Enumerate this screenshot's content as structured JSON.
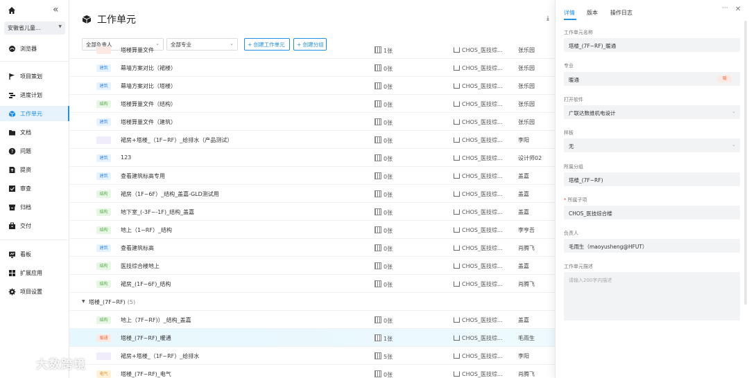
{
  "sidebar": {
    "project": "安徽省儿童...",
    "items": [
      {
        "label": "浏览器",
        "icon": "cloud-icon"
      },
      {
        "label": "项目策划",
        "icon": "flag-icon"
      },
      {
        "label": "进度计划",
        "icon": "schedule-icon"
      },
      {
        "label": "工作单元",
        "icon": "cube-icon",
        "active": true
      },
      {
        "label": "文档",
        "icon": "folder-icon"
      },
      {
        "label": "问题",
        "icon": "question-icon"
      },
      {
        "label": "提资",
        "icon": "submit-icon"
      },
      {
        "label": "审查",
        "icon": "review-icon"
      },
      {
        "label": "归档",
        "icon": "archive-icon"
      },
      {
        "label": "交付",
        "icon": "delivery-icon"
      },
      {
        "label": "看板",
        "icon": "dashboard-icon"
      },
      {
        "label": "扩展应用",
        "icon": "apps-icon"
      },
      {
        "label": "项目设置",
        "icon": "settings-icon"
      }
    ]
  },
  "main": {
    "title": "工作单元",
    "filters": {
      "owner": "全部负责人",
      "discipline": "全部专业"
    },
    "buttons": {
      "create_unit": "+ 创建工作单元",
      "create_group": "+ 创建分组"
    },
    "rows": [
      {
        "tag": "",
        "tag_class": "nt",
        "name": "塔楼算量文件",
        "count": "1张",
        "sub": "CHOS_医技综...",
        "owner": "张乐园"
      },
      {
        "tag": "建筑",
        "tag_class": "jz",
        "name": "幕墙方案对比（裙楼）",
        "count": "0张",
        "sub": "CHOS_医技综...",
        "owner": "张乐园"
      },
      {
        "tag": "建筑",
        "tag_class": "jz",
        "name": "幕墙方案对比（塔楼）",
        "count": "0张",
        "sub": "CHOS_医技综...",
        "owner": "张乐园"
      },
      {
        "tag": "结构",
        "tag_class": "jg",
        "name": "塔楼算量文件（结构）",
        "count": "0张",
        "sub": "CHOS_医技综...",
        "owner": "张乐园"
      },
      {
        "tag": "建筑",
        "tag_class": "jz",
        "name": "塔楼算量文件（建筑）",
        "count": "0张",
        "sub": "CHOS_医技综...",
        "owner": "张乐园"
      },
      {
        "tag": "",
        "tag_class": "gps",
        "name": "裙房+塔楼_（1F~RF）_给排水（产品测试）",
        "count": "0张",
        "sub": "CHOS_医技综...",
        "owner": "李阳"
      },
      {
        "tag": "建筑",
        "tag_class": "jz",
        "name": "123",
        "count": "0张",
        "sub": "CHOS_医技综...",
        "owner": "设计师02"
      },
      {
        "tag": "建筑",
        "tag_class": "jz",
        "name": "查看建筑标高专用",
        "count": "0张",
        "sub": "CHOS_医技综...",
        "owner": "盖嘉"
      },
      {
        "tag": "结构",
        "tag_class": "jg",
        "name": "裙房（1F~6F）_结构_盖嘉-GLD测试用",
        "count": "0张",
        "sub": "CHOS_医技综...",
        "owner": "盖嘉"
      },
      {
        "tag": "结构",
        "tag_class": "jg",
        "name": "地下室_(-3F~-1F)_结构_盖嘉",
        "count": "0张",
        "sub": "CHOS_医技综...",
        "owner": "盖嘉"
      },
      {
        "tag": "结构",
        "tag_class": "jg",
        "name": "地上（1~RF）_结构",
        "count": "0张",
        "sub": "CHOS_医技综...",
        "owner": "李亨吾"
      },
      {
        "tag": "建筑",
        "tag_class": "jz",
        "name": "查看建筑标高",
        "count": "0张",
        "sub": "CHOS_医技综...",
        "owner": "肖腾飞"
      },
      {
        "tag": "结构",
        "tag_class": "jg",
        "name": "医技综合楼地上",
        "count": "0张",
        "sub": "CHOS_医技综...",
        "owner": "盖嘉"
      },
      {
        "tag": "结构",
        "tag_class": "jg",
        "name": "裙房_(1F~6F)_结构",
        "count": "0张",
        "sub": "CHOS_医技综...",
        "owner": "肖腾飞"
      }
    ],
    "group": {
      "label": "塔楼_(7F~RF)",
      "count": "(5)"
    },
    "group_rows": [
      {
        "tag": "结构",
        "tag_class": "jg",
        "name": "地上（7F~RF)）_结构_盖嘉",
        "count": "0张",
        "sub": "CHOS_医技综...",
        "owner": "盖嘉"
      },
      {
        "tag": "暖通",
        "tag_class": "nt",
        "name": "塔楼_(7F~RF)_暖通",
        "count": "1张",
        "sub": "CHOS_医技综...",
        "owner": "毛雨生",
        "selected": true
      },
      {
        "tag": "",
        "tag_class": "gps",
        "name": "裙房+塔楼_（1F~RF）_给排水",
        "count": "5张",
        "sub": "CHOS_医技综...",
        "owner": "李阳"
      },
      {
        "tag": "电气",
        "tag_class": "dq",
        "name": "塔楼_(7F~RF)_电气",
        "count": "0张",
        "sub": "CHOS_医技综...",
        "owner": "肖腾飞"
      }
    ]
  },
  "panel": {
    "tabs": [
      "详情",
      "版本",
      "操作日志"
    ],
    "fields": {
      "unit_name_label": "工作单元名称",
      "unit_name": "塔楼_(7F~RF)_暖通",
      "discipline_label": "专业",
      "discipline": "暖通",
      "discipline_badge": "暖",
      "software_label": "打开软件",
      "software": "广联达数维机电设计",
      "template_label": "样板",
      "template": "无",
      "group_label": "所属分组",
      "group": "塔楼_(7F~RF)",
      "subproject_label": "所属子项",
      "subproject": "CHOS_医技综合楼",
      "owner_label": "负责人",
      "owner": "毛雨生（maoyusheng@HFUT）",
      "desc_label": "工作单元描述",
      "desc_placeholder": "请输入200字内描述"
    }
  },
  "watermark": "大数跨境"
}
